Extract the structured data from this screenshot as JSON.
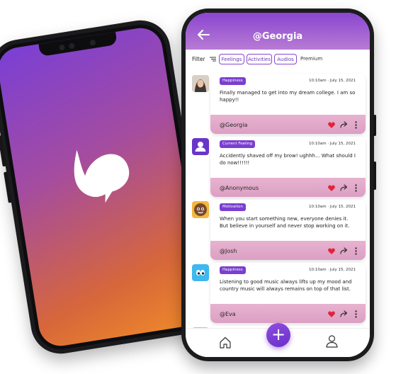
{
  "header": {
    "handle": "@Georgia"
  },
  "filter": {
    "label": "Filter",
    "chips": [
      "Feelings",
      "Activities",
      "Audios"
    ],
    "premium": "Premium"
  },
  "posts": [
    {
      "tag": "Happiness",
      "time": "10:10am · July 15, 2021",
      "text": "Finally managed to get into my dream college. I am so happy!!",
      "author": "@Georgia",
      "avatar": "photo"
    },
    {
      "tag": "Current Feeling",
      "time": "10:10am · July 15, 2021",
      "text": "Accidently shaved off my brow! ughhh... What should I do now!!!!!!",
      "author": "@Anonymous",
      "avatar": "anonymous-user-icon"
    },
    {
      "tag": "Motivation",
      "time": "10:10am · July 15, 2021",
      "text": "When you start something new, everyone denies it. But believe in yourself and never stop working on it.",
      "author": "@Josh",
      "avatar": "emoji-face"
    },
    {
      "tag": "Happiness",
      "time": "10:10am · July 15, 2021",
      "text": "Listening to good music always lifts up my mood and country music will always remains on top of that list.",
      "author": "@Eva",
      "avatar": "eyes-emoji"
    }
  ],
  "nav": {
    "add_label": "+"
  },
  "colors": {
    "brand": "#7a3fd0",
    "heart": "#e0243a"
  }
}
